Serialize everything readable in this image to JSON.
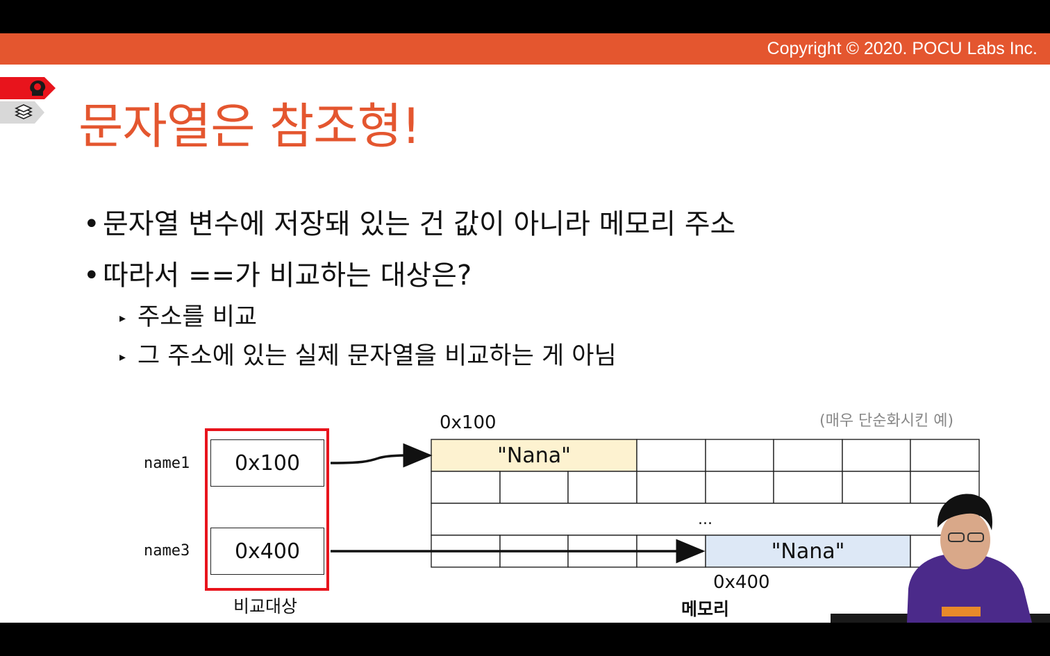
{
  "banner": {
    "copyright": "Copyright © 2020. POCU Labs Inc.",
    "color": "#e4562f"
  },
  "icons": {
    "brain": "brain-head-icon",
    "books": "book-stack-icon"
  },
  "title": "문자열은 참조형!",
  "bullets": [
    {
      "text": "문자열 변수에 저장돼 있는 건 값이 아니라 메모리 주소"
    },
    {
      "text": "따라서 ==가 비교하는 대상은?"
    }
  ],
  "sub_bullets": [
    {
      "text": "주소를 비교"
    },
    {
      "text": "그 주소에 있는 실제 문자열을 비교하는 게 아님"
    }
  ],
  "bullet_glyph": "•",
  "sub_glyph": "▸",
  "diagram": {
    "note": "(매우 단순화시킨 예)",
    "variables": [
      {
        "name": "name1",
        "value": "0x100"
      },
      {
        "name": "name3",
        "value": "0x400"
      }
    ],
    "compare_caption": "비교대상",
    "memory_caption": "메모리",
    "address_top": "0x100",
    "address_bottom": "0x400",
    "string_top": "\"Nana\"",
    "string_bottom": "\"Nana\"",
    "ellipsis": "...",
    "colors": {
      "highlight_frame": "#e8141c",
      "string_top_fill": "#fdf2d0",
      "string_bottom_fill": "#dde8f6"
    }
  }
}
